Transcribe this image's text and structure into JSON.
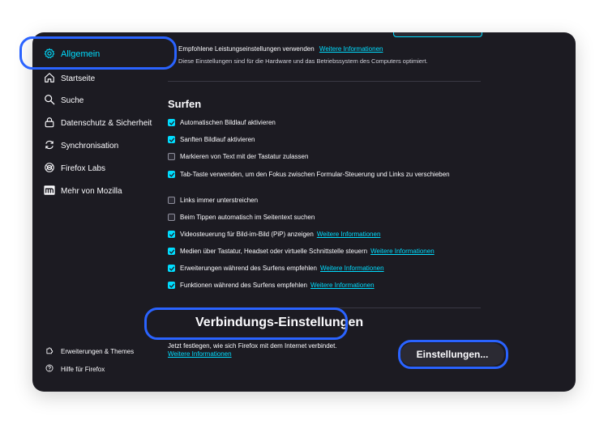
{
  "sidebar": {
    "items": [
      {
        "label": "Allgemein",
        "icon": "gear-icon",
        "selected": true
      },
      {
        "label": "Startseite",
        "icon": "home-icon"
      },
      {
        "label": "Suche",
        "icon": "search-icon"
      },
      {
        "label": "Datenschutz & Sicherheit",
        "icon": "lock-icon"
      },
      {
        "label": "Synchronisation",
        "icon": "sync-icon"
      },
      {
        "label": "Firefox Labs",
        "icon": "labs-flask-icon"
      },
      {
        "label": "Mehr von Mozilla",
        "icon": "mozilla-m-icon"
      }
    ],
    "footer": [
      {
        "label": "Erweiterungen & Themes",
        "icon": "puzzle-icon"
      },
      {
        "label": "Hilfe für Firefox",
        "icon": "help-icon"
      }
    ]
  },
  "performance": {
    "recommended_label": "Empfohlene Leistungseinstellungen verwenden",
    "recommended_link": "Weitere Informationen",
    "description": "Diese Einstellungen sind für die Hardware und das Betriebssystem des Computers optimiert."
  },
  "browsing": {
    "title": "Surfen",
    "options": [
      {
        "label": "Automatischen Bildlauf aktivieren",
        "checked": true
      },
      {
        "label": "Sanften Bildlauf aktivieren",
        "checked": true
      },
      {
        "label": "Markieren von Text mit der Tastatur zulassen",
        "checked": false
      },
      {
        "label": "Tab-Taste verwenden, um den Fokus zwischen Formular-Steuerung und Links zu verschieben",
        "checked": true
      },
      {
        "label": "Links immer unterstreichen",
        "checked": false
      },
      {
        "label": "Beim Tippen automatisch im Seitentext suchen",
        "checked": false
      },
      {
        "label": "Videosteuerung für Bild-im-Bild (PiP) anzeigen",
        "checked": true,
        "link": "Weitere Informationen"
      },
      {
        "label": "Medien über Tastatur, Headset oder virtuelle Schnittstelle steuern",
        "checked": true,
        "link": "Weitere Informationen"
      },
      {
        "label": "Erweiterungen während des Surfens empfehlen",
        "checked": true,
        "link": "Weitere Informationen"
      },
      {
        "label": "Funktionen während des Surfens empfehlen",
        "checked": true,
        "link": "Weitere Informationen"
      }
    ]
  },
  "connection": {
    "title": "Verbindungs-Einstellungen",
    "description": "Jetzt festlegen, wie sich Firefox mit dem Internet verbindet.",
    "link": "Weitere Informationen",
    "button": "Einstellungen..."
  },
  "colors": {
    "accent": "#00ddff",
    "highlight": "#2a63ff",
    "background": "#1c1b22"
  }
}
